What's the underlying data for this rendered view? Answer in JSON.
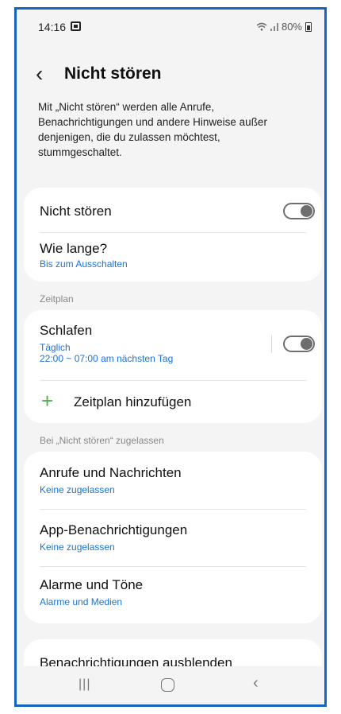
{
  "status_bar": {
    "time": "14:16",
    "battery": "80%"
  },
  "header": {
    "title": "Nicht stören"
  },
  "description": "Mit „Nicht stören“ werden alle Anrufe, Benachrichtigungen und andere Hinweise außer denjenigen, die du zulassen möchtest, stummgeschaltet.",
  "main_card": {
    "dnd_toggle_label": "Nicht stören",
    "dnd_enabled": false,
    "duration_title": "Wie lange?",
    "duration_value": "Bis zum Ausschalten"
  },
  "schedule": {
    "section_label": "Zeitplan",
    "sleep_title": "Schlafen",
    "sleep_days": "Täglich",
    "sleep_time": "22:00 ~ 07:00 am nächsten Tag",
    "sleep_enabled": false,
    "add_label": "Zeitplan hinzufügen"
  },
  "allowed": {
    "section_label": "Bei „Nicht stören“ zugelassen",
    "calls_title": "Anrufe und Nachrichten",
    "calls_value": "Keine zugelassen",
    "apps_title": "App-Benachrichtigungen",
    "apps_value": "Keine zugelassen",
    "alarms_title": "Alarme und Töne",
    "alarms_value": "Alarme und Medien"
  },
  "hide": {
    "title": "Benachrichtigungen ausblenden"
  },
  "nav": {
    "recents_icon": "recents-icon",
    "home_icon": "home-icon",
    "back_icon": "back-icon"
  },
  "colors": {
    "accent_blue": "#1c73d1",
    "add_green": "#4caf50",
    "frame_border": "#1565c0"
  }
}
